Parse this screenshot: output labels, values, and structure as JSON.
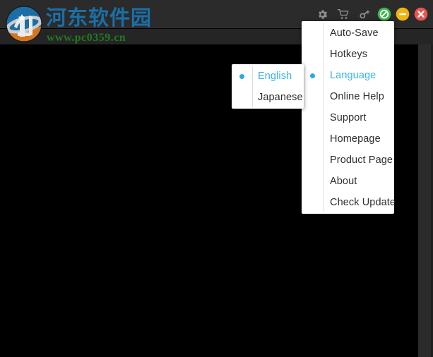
{
  "window": {
    "background_color": "#000000",
    "titlebar_color": "#2b2b2b",
    "frame_color": "#2b2b2b"
  },
  "watermark": {
    "logo_icon": "site-logo-icon",
    "site_name": "河东软件园",
    "site_url": "www.pc0359.cn",
    "site_name_color": "#1b6fa8",
    "site_url_color": "#1f7a1f"
  },
  "toolbar": {
    "buttons": [
      {
        "name": "settings-gear-button",
        "icon": "gear-icon",
        "label": "Settings"
      },
      {
        "name": "cart-button",
        "icon": "shopping-cart-icon",
        "label": "Buy"
      },
      {
        "name": "register-key-button",
        "icon": "key-icon",
        "label": "Register"
      },
      {
        "name": "record-stop-button",
        "icon": "prohibited-icon",
        "label": "Stop",
        "color": "#3bb54a"
      },
      {
        "name": "minimize-button",
        "icon": "minus-icon",
        "label": "Minimize",
        "color": "#f0b412"
      },
      {
        "name": "close-button",
        "icon": "close-x-icon",
        "label": "Close",
        "color": "#e8554e"
      }
    ]
  },
  "settings_menu": {
    "accent_color": "#37b3f0",
    "bullet_color": "#2aa9e0",
    "items": [
      {
        "label": "Auto-Save",
        "checked": false,
        "active": false
      },
      {
        "label": "Hotkeys",
        "checked": false,
        "active": false
      },
      {
        "label": "Language",
        "checked": true,
        "active": true
      },
      {
        "label": "Online Help",
        "checked": false,
        "active": false
      },
      {
        "label": "Support",
        "checked": false,
        "active": false
      },
      {
        "label": "Homepage",
        "checked": false,
        "active": false
      },
      {
        "label": "Product Page",
        "checked": false,
        "active": false
      },
      {
        "label": "About",
        "checked": false,
        "active": false
      },
      {
        "label": "Check Update",
        "checked": false,
        "active": false
      }
    ]
  },
  "language_submenu": {
    "items": [
      {
        "label": "English",
        "checked": true,
        "active": true
      },
      {
        "label": "Japanese",
        "checked": false,
        "active": false
      }
    ]
  }
}
